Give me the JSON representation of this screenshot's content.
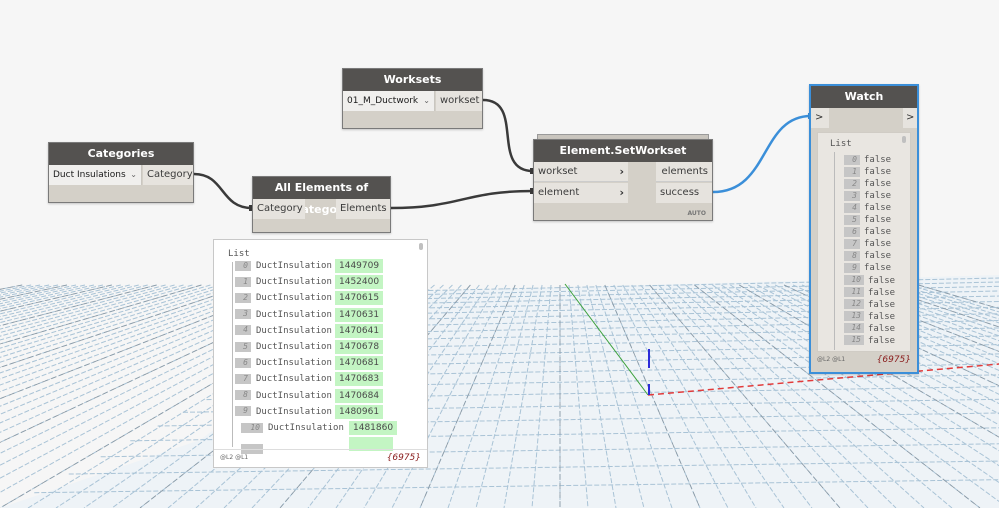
{
  "canvas": {
    "wire_color": "#3a3a3a",
    "selected_wire_color": "#3b8fd9",
    "axis_colors": {
      "x": "#e23b3b",
      "y": "#3aa03a",
      "z": "#2b2bd9"
    }
  },
  "nodes": {
    "categories": {
      "title": "Categories",
      "dropdown_value": "Duct Insulations",
      "output_port": "Category"
    },
    "worksets": {
      "title": "Worksets",
      "dropdown_value": "01_M_Ductwork",
      "output_port": "workset"
    },
    "all_elements": {
      "title": "All Elements of Category",
      "input_port": "Category",
      "output_port": "Elements"
    },
    "set_workset": {
      "title": "Element.SetWorkset",
      "inputs": [
        "workset",
        "element"
      ],
      "outputs": [
        "elements",
        "success"
      ],
      "lacing": "AUTO"
    },
    "watch": {
      "title": "Watch",
      "input_port": ">",
      "output_port": ">",
      "list_label": "List",
      "items": [
        {
          "index": "0",
          "value": "false"
        },
        {
          "index": "1",
          "value": "false"
        },
        {
          "index": "2",
          "value": "false"
        },
        {
          "index": "3",
          "value": "false"
        },
        {
          "index": "4",
          "value": "false"
        },
        {
          "index": "5",
          "value": "false"
        },
        {
          "index": "6",
          "value": "false"
        },
        {
          "index": "7",
          "value": "false"
        },
        {
          "index": "8",
          "value": "false"
        },
        {
          "index": "9",
          "value": "false"
        },
        {
          "index": "10",
          "value": "false"
        },
        {
          "index": "11",
          "value": "false"
        },
        {
          "index": "12",
          "value": "false"
        },
        {
          "index": "13",
          "value": "false"
        },
        {
          "index": "14",
          "value": "false"
        },
        {
          "index": "15",
          "value": "false"
        }
      ],
      "levels": "@L2 @L1",
      "count": "{6975}"
    }
  },
  "preview": {
    "list_label": "List",
    "items": [
      {
        "index": "0",
        "type": "DuctInsulation",
        "id": "1449709"
      },
      {
        "index": "1",
        "type": "DuctInsulation",
        "id": "1452400"
      },
      {
        "index": "2",
        "type": "DuctInsulation",
        "id": "1470615"
      },
      {
        "index": "3",
        "type": "DuctInsulation",
        "id": "1470631"
      },
      {
        "index": "4",
        "type": "DuctInsulation",
        "id": "1470641"
      },
      {
        "index": "5",
        "type": "DuctInsulation",
        "id": "1470678"
      },
      {
        "index": "6",
        "type": "DuctInsulation",
        "id": "1470681"
      },
      {
        "index": "7",
        "type": "DuctInsulation",
        "id": "1470683"
      },
      {
        "index": "8",
        "type": "DuctInsulation",
        "id": "1470684"
      },
      {
        "index": "9",
        "type": "DuctInsulation",
        "id": "1480961"
      },
      {
        "index": "10",
        "type": "DuctInsulation",
        "id": "1481860"
      }
    ],
    "levels": "@L2 @L1",
    "count": "{6975}"
  }
}
